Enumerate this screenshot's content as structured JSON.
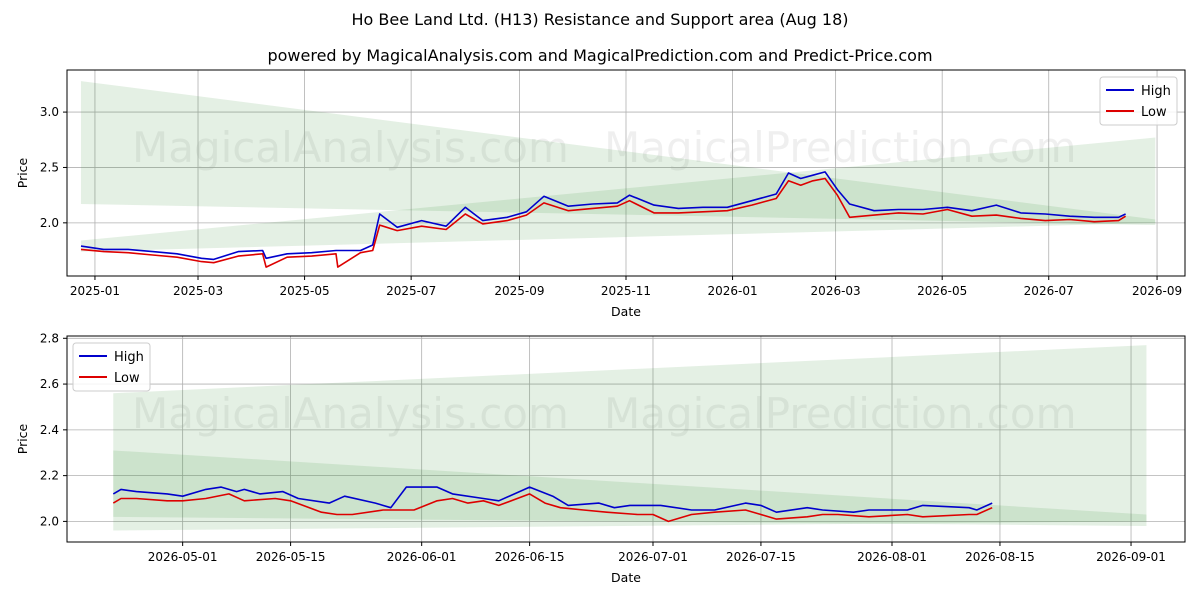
{
  "title": "Ho Bee Land Ltd. (H13) Resistance and Support area (Aug 18)",
  "subtitle": "powered by MagicalAnalysis.com and MagicalPrediction.com and Predict-Price.com",
  "watermarks": [
    "MagicalAnalysis.com",
    "MagicalPrediction.com"
  ],
  "colors": {
    "high": "#0000cc",
    "low": "#dd0000",
    "band": "#2e8b2e"
  },
  "chart_data": [
    {
      "type": "line",
      "xlabel": "Date",
      "ylabel": "Price",
      "xlim": [
        "2024-12-16",
        "2026-09-17"
      ],
      "ylim": [
        1.52,
        3.38
      ],
      "x_ticks": [
        "2025-01",
        "2025-03",
        "2025-05",
        "2025-07",
        "2025-09",
        "2025-11",
        "2026-01",
        "2026-03",
        "2026-05",
        "2026-07",
        "2026-09"
      ],
      "y_ticks": [
        2.0,
        2.5,
        3.0
      ],
      "legend": {
        "position": "top-right",
        "entries": [
          "High",
          "Low"
        ]
      },
      "bands": [
        {
          "x": [
            "2024-12-24",
            "2026-08-31"
          ],
          "upper": [
            3.28,
            2.03
          ],
          "lower": [
            2.17,
            1.98
          ]
        },
        {
          "x": [
            "2024-12-24",
            "2026-08-31"
          ],
          "upper": [
            1.84,
            2.77
          ],
          "lower": [
            1.74,
            2.0
          ]
        }
      ],
      "series": [
        {
          "name": "High",
          "x": [
            "2024-12-24",
            "2025-01-06",
            "2025-01-20",
            "2025-02-03",
            "2025-02-17",
            "2025-03-03",
            "2025-03-10",
            "2025-03-24",
            "2025-04-07",
            "2025-04-09",
            "2025-04-21",
            "2025-05-05",
            "2025-05-19",
            "2025-06-02",
            "2025-06-09",
            "2025-06-13",
            "2025-06-23",
            "2025-07-07",
            "2025-07-21",
            "2025-08-01",
            "2025-08-11",
            "2025-08-25",
            "2025-09-05",
            "2025-09-15",
            "2025-09-29",
            "2025-10-13",
            "2025-10-27",
            "2025-11-03",
            "2025-11-17",
            "2025-12-01",
            "2025-12-15",
            "2025-12-29",
            "2026-01-12",
            "2026-01-26",
            "2026-02-02",
            "2026-02-09",
            "2026-02-16",
            "2026-02-23",
            "2026-03-02",
            "2026-03-09",
            "2026-03-23",
            "2026-04-06",
            "2026-04-20",
            "2026-05-04",
            "2026-05-18",
            "2026-06-01",
            "2026-06-15",
            "2026-06-29",
            "2026-07-13",
            "2026-07-27",
            "2026-08-10",
            "2026-08-14"
          ],
          "values": [
            1.79,
            1.76,
            1.76,
            1.74,
            1.72,
            1.68,
            1.67,
            1.74,
            1.75,
            1.68,
            1.72,
            1.73,
            1.75,
            1.75,
            1.8,
            2.08,
            1.96,
            2.02,
            1.97,
            2.14,
            2.02,
            2.05,
            2.1,
            2.24,
            2.15,
            2.17,
            2.18,
            2.25,
            2.16,
            2.13,
            2.14,
            2.14,
            2.2,
            2.26,
            2.45,
            2.4,
            2.43,
            2.46,
            2.3,
            2.17,
            2.11,
            2.12,
            2.12,
            2.14,
            2.11,
            2.16,
            2.09,
            2.08,
            2.06,
            2.05,
            2.05,
            2.08
          ]
        },
        {
          "name": "Low",
          "x": [
            "2024-12-24",
            "2025-01-06",
            "2025-01-20",
            "2025-02-03",
            "2025-02-17",
            "2025-03-03",
            "2025-03-10",
            "2025-03-24",
            "2025-04-07",
            "2025-04-09",
            "2025-04-21",
            "2025-05-05",
            "2025-05-19",
            "2025-05-20",
            "2025-06-02",
            "2025-06-09",
            "2025-06-13",
            "2025-06-23",
            "2025-07-07",
            "2025-07-21",
            "2025-08-01",
            "2025-08-11",
            "2025-08-25",
            "2025-09-05",
            "2025-09-15",
            "2025-09-29",
            "2025-10-13",
            "2025-10-27",
            "2025-11-03",
            "2025-11-17",
            "2025-12-01",
            "2025-12-15",
            "2025-12-29",
            "2026-01-12",
            "2026-01-26",
            "2026-02-02",
            "2026-02-09",
            "2026-02-16",
            "2026-02-23",
            "2026-03-02",
            "2026-03-09",
            "2026-03-23",
            "2026-04-06",
            "2026-04-20",
            "2026-05-04",
            "2026-05-18",
            "2026-06-01",
            "2026-06-15",
            "2026-06-29",
            "2026-07-13",
            "2026-07-27",
            "2026-08-10",
            "2026-08-14"
          ],
          "values": [
            1.76,
            1.74,
            1.73,
            1.71,
            1.69,
            1.65,
            1.64,
            1.7,
            1.72,
            1.6,
            1.69,
            1.7,
            1.72,
            1.6,
            1.73,
            1.75,
            1.98,
            1.93,
            1.97,
            1.94,
            2.08,
            1.99,
            2.02,
            2.07,
            2.18,
            2.11,
            2.13,
            2.15,
            2.2,
            2.09,
            2.09,
            2.1,
            2.11,
            2.16,
            2.22,
            2.38,
            2.34,
            2.38,
            2.4,
            2.25,
            2.05,
            2.07,
            2.09,
            2.08,
            2.12,
            2.06,
            2.07,
            2.04,
            2.02,
            2.03,
            2.01,
            2.02,
            2.06
          ]
        }
      ]
    },
    {
      "type": "line",
      "xlabel": "Date",
      "ylabel": "Price",
      "xlim": [
        "2026-04-16",
        "2026-09-08"
      ],
      "ylim": [
        1.91,
        2.81
      ],
      "x_ticks": [
        "2026-05-01",
        "2026-05-15",
        "2026-06-01",
        "2026-06-15",
        "2026-07-01",
        "2026-07-15",
        "2026-08-01",
        "2026-08-15",
        "2026-09-01"
      ],
      "y_ticks": [
        2.0,
        2.2,
        2.4,
        2.6,
        2.8
      ],
      "legend": {
        "position": "top-left",
        "entries": [
          "High",
          "Low"
        ]
      },
      "bands": [
        {
          "x": [
            "2026-04-22",
            "2026-09-03"
          ],
          "upper": [
            2.31,
            2.03
          ],
          "lower": [
            1.96,
            2.0
          ]
        },
        {
          "x": [
            "2026-04-22",
            "2026-09-03"
          ],
          "upper": [
            2.56,
            2.77
          ],
          "lower": [
            2.02,
            1.98
          ]
        }
      ],
      "series": [
        {
          "name": "High",
          "x": [
            "2026-04-22",
            "2026-04-23",
            "2026-04-25",
            "2026-04-29",
            "2026-05-01",
            "2026-05-04",
            "2026-05-06",
            "2026-05-08",
            "2026-05-09",
            "2026-05-11",
            "2026-05-14",
            "2026-05-16",
            "2026-05-20",
            "2026-05-22",
            "2026-05-26",
            "2026-05-28",
            "2026-05-30",
            "2026-06-01",
            "2026-06-03",
            "2026-06-05",
            "2026-06-09",
            "2026-06-11",
            "2026-06-15",
            "2026-06-18",
            "2026-06-20",
            "2026-06-24",
            "2026-06-26",
            "2026-06-28",
            "2026-07-02",
            "2026-07-06",
            "2026-07-09",
            "2026-07-13",
            "2026-07-15",
            "2026-07-17",
            "2026-07-21",
            "2026-07-23",
            "2026-07-27",
            "2026-07-29",
            "2026-08-03",
            "2026-08-05",
            "2026-08-11",
            "2026-08-12",
            "2026-08-14"
          ],
          "values": [
            2.12,
            2.14,
            2.13,
            2.12,
            2.11,
            2.14,
            2.15,
            2.13,
            2.14,
            2.12,
            2.13,
            2.1,
            2.08,
            2.11,
            2.08,
            2.06,
            2.15,
            2.15,
            2.15,
            2.12,
            2.1,
            2.09,
            2.15,
            2.11,
            2.07,
            2.08,
            2.06,
            2.07,
            2.07,
            2.05,
            2.05,
            2.08,
            2.07,
            2.04,
            2.06,
            2.05,
            2.04,
            2.05,
            2.05,
            2.07,
            2.06,
            2.05,
            2.08
          ]
        },
        {
          "name": "Low",
          "x": [
            "2026-04-22",
            "2026-04-23",
            "2026-04-25",
            "2026-04-29",
            "2026-05-01",
            "2026-05-04",
            "2026-05-07",
            "2026-05-09",
            "2026-05-13",
            "2026-05-15",
            "2026-05-19",
            "2026-05-21",
            "2026-05-23",
            "2026-05-27",
            "2026-05-29",
            "2026-05-31",
            "2026-06-03",
            "2026-06-05",
            "2026-06-07",
            "2026-06-09",
            "2026-06-11",
            "2026-06-15",
            "2026-06-17",
            "2026-06-19",
            "2026-06-22",
            "2026-06-25",
            "2026-06-29",
            "2026-07-01",
            "2026-07-03",
            "2026-07-06",
            "2026-07-09",
            "2026-07-13",
            "2026-07-15",
            "2026-07-17",
            "2026-07-21",
            "2026-07-23",
            "2026-07-25",
            "2026-07-29",
            "2026-08-03",
            "2026-08-05",
            "2026-08-11",
            "2026-08-12",
            "2026-08-14"
          ],
          "values": [
            2.08,
            2.1,
            2.1,
            2.09,
            2.09,
            2.1,
            2.12,
            2.09,
            2.1,
            2.09,
            2.04,
            2.03,
            2.03,
            2.05,
            2.05,
            2.05,
            2.09,
            2.1,
            2.08,
            2.09,
            2.07,
            2.12,
            2.08,
            2.06,
            2.05,
            2.04,
            2.03,
            2.03,
            2.0,
            2.03,
            2.04,
            2.05,
            2.03,
            2.01,
            2.02,
            2.03,
            2.03,
            2.02,
            2.03,
            2.02,
            2.03,
            2.03,
            2.06
          ]
        }
      ]
    }
  ]
}
